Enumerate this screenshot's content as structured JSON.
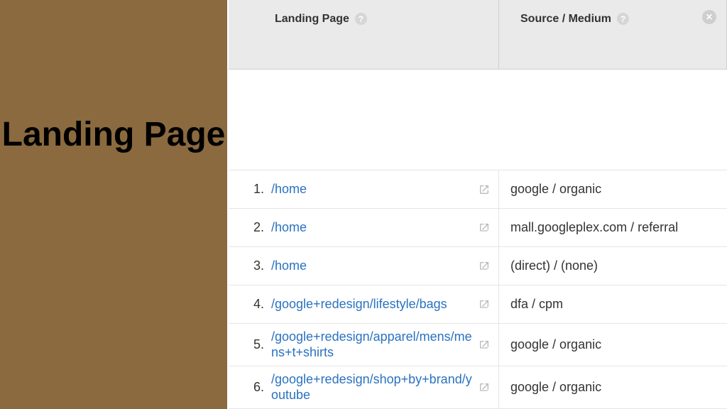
{
  "left_panel": {
    "title": "Landing Page"
  },
  "table": {
    "headers": {
      "landing": "Landing Page",
      "source": "Source / Medium"
    },
    "rows": [
      {
        "num": "1.",
        "page": "/home",
        "source": "google / organic"
      },
      {
        "num": "2.",
        "page": "/home",
        "source": "mall.googleplex.com / referral"
      },
      {
        "num": "3.",
        "page": "/home",
        "source": "(direct) / (none)"
      },
      {
        "num": "4.",
        "page": "/google+redesign/lifestyle/bags",
        "source": "dfa / cpm"
      },
      {
        "num": "5.",
        "page": "/google+redesign/apparel/mens/mens+t+shirts",
        "source": "google / organic"
      },
      {
        "num": "6.",
        "page": "/google+redesign/shop+by+brand/youtube",
        "source": "google / organic"
      }
    ]
  }
}
